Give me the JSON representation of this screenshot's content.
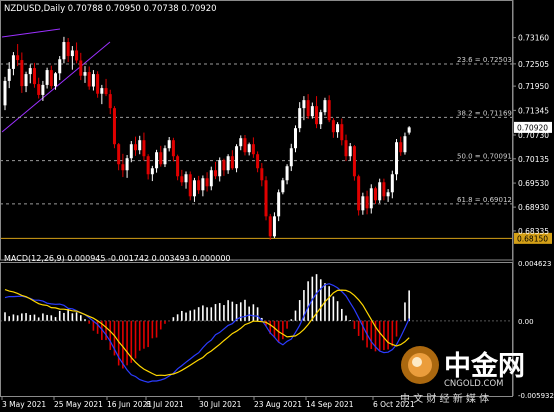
{
  "header": {
    "symbol_line": "NZDUSD,Daily  0.70788 0.70950 0.70738 0.70920"
  },
  "macd_header": "MACD(12,26,9) 0.000945 -0.001742 0.003493 0.000000",
  "fib_levels": [
    {
      "label": "23.6 = 0.72503",
      "value": 0.72503
    },
    {
      "label": "38.2 = 0.71169",
      "value": 0.71169
    },
    {
      "label": "50.0 = 0.70091",
      "value": 0.70091
    },
    {
      "label": "61.8 = 0.69012",
      "value": 0.69012
    }
  ],
  "support_line": {
    "value": 0.6815,
    "label": "0.68150",
    "color": "#d4a017"
  },
  "current_price": {
    "value": 0.7092,
    "label": "0.70920"
  },
  "watermark": {
    "brand": "中金网",
    "url": "CNGOLD.COM",
    "slogan": "中 文 财 经 新 媒 体"
  },
  "colors": {
    "bull": "#ffffff",
    "bear": "#e00000",
    "macd_line": "#2b3cff",
    "signal_line": "#ffd700",
    "trend": "#9b30ff"
  },
  "chart_data": {
    "type": "candlestick",
    "title": "NZDUSD,Daily",
    "price_axis": {
      "min": 0.6761,
      "max": 0.7365,
      "ticks": [
        "0.73160",
        "0.72505",
        "0.71950",
        "0.71345",
        "0.70730",
        "0.70135",
        "0.69530",
        "0.68930",
        "0.68335"
      ]
    },
    "time_axis": [
      "3 May 2021",
      "25 May 2021",
      "16 Jun 2021",
      "8 Jul 2021",
      "30 Jul 2021",
      "23 Aug 2021",
      "14 Sep 2021",
      "6 Oct 2021"
    ],
    "candles": [
      [
        0.7147,
        0.7218,
        0.7135,
        0.7208
      ],
      [
        0.7208,
        0.7255,
        0.719,
        0.7238
      ],
      [
        0.7238,
        0.728,
        0.7222,
        0.7272
      ],
      [
        0.7272,
        0.73,
        0.7245,
        0.726
      ],
      [
        0.726,
        0.7279,
        0.7178,
        0.7195
      ],
      [
        0.7195,
        0.7231,
        0.718,
        0.7225
      ],
      [
        0.7225,
        0.7249,
        0.7202,
        0.724
      ],
      [
        0.724,
        0.7253,
        0.7191,
        0.72
      ],
      [
        0.72,
        0.7216,
        0.7164,
        0.7173
      ],
      [
        0.7173,
        0.7208,
        0.7158,
        0.7198
      ],
      [
        0.7198,
        0.7241,
        0.7189,
        0.7235
      ],
      [
        0.7235,
        0.7246,
        0.7188,
        0.7195
      ],
      [
        0.7195,
        0.723,
        0.7186,
        0.7227
      ],
      [
        0.7227,
        0.727,
        0.721,
        0.7262
      ],
      [
        0.7262,
        0.7318,
        0.7252,
        0.7305
      ],
      [
        0.7305,
        0.7315,
        0.7255,
        0.727
      ],
      [
        0.727,
        0.7295,
        0.7236,
        0.7284
      ],
      [
        0.7284,
        0.7304,
        0.7252,
        0.7259
      ],
      [
        0.7259,
        0.7278,
        0.721,
        0.7221
      ],
      [
        0.7221,
        0.7245,
        0.7203,
        0.723
      ],
      [
        0.723,
        0.7244,
        0.7186,
        0.7194
      ],
      [
        0.7194,
        0.7235,
        0.7184,
        0.7225
      ],
      [
        0.7225,
        0.7232,
        0.7166,
        0.7176
      ],
      [
        0.7176,
        0.7198,
        0.715,
        0.719
      ],
      [
        0.719,
        0.7213,
        0.717,
        0.7175
      ],
      [
        0.7175,
        0.7186,
        0.7125,
        0.714
      ],
      [
        0.714,
        0.7145,
        0.704,
        0.705
      ],
      [
        0.705,
        0.7053,
        0.6985,
        0.7
      ],
      [
        0.7,
        0.7026,
        0.6968,
        0.6985
      ],
      [
        0.6985,
        0.7023,
        0.6966,
        0.7015
      ],
      [
        0.7015,
        0.7058,
        0.7005,
        0.705
      ],
      [
        0.705,
        0.7069,
        0.7021,
        0.7035
      ],
      [
        0.7035,
        0.7071,
        0.7025,
        0.706
      ],
      [
        0.706,
        0.7079,
        0.7009,
        0.702
      ],
      [
        0.702,
        0.7025,
        0.6962,
        0.6975
      ],
      [
        0.6975,
        0.6996,
        0.6958,
        0.699
      ],
      [
        0.699,
        0.7036,
        0.6979,
        0.703
      ],
      [
        0.703,
        0.7046,
        0.6994,
        0.7
      ],
      [
        0.7,
        0.7047,
        0.6993,
        0.704
      ],
      [
        0.704,
        0.7068,
        0.7032,
        0.706
      ],
      [
        0.706,
        0.7066,
        0.7007,
        0.702
      ],
      [
        0.702,
        0.7024,
        0.696,
        0.697
      ],
      [
        0.697,
        0.6986,
        0.6946,
        0.6955
      ],
      [
        0.6955,
        0.6982,
        0.6939,
        0.6975
      ],
      [
        0.6975,
        0.6982,
        0.691,
        0.692
      ],
      [
        0.692,
        0.6966,
        0.6906,
        0.696
      ],
      [
        0.696,
        0.6971,
        0.6926,
        0.6935
      ],
      [
        0.6935,
        0.6972,
        0.692,
        0.6965
      ],
      [
        0.6965,
        0.698,
        0.6932,
        0.6945
      ],
      [
        0.6945,
        0.6994,
        0.6935,
        0.6985
      ],
      [
        0.6985,
        0.7006,
        0.6963,
        0.697
      ],
      [
        0.697,
        0.7017,
        0.6957,
        0.701
      ],
      [
        0.701,
        0.7014,
        0.6971,
        0.6985
      ],
      [
        0.6985,
        0.7025,
        0.6976,
        0.702
      ],
      [
        0.702,
        0.7035,
        0.6986,
        0.699
      ],
      [
        0.699,
        0.705,
        0.698,
        0.7045
      ],
      [
        0.7045,
        0.7072,
        0.7035,
        0.7065
      ],
      [
        0.7065,
        0.7073,
        0.7022,
        0.703
      ],
      [
        0.703,
        0.7054,
        0.7022,
        0.705
      ],
      [
        0.705,
        0.7067,
        0.7016,
        0.7025
      ],
      [
        0.7025,
        0.7032,
        0.698,
        0.699
      ],
      [
        0.699,
        0.7003,
        0.6945,
        0.696
      ],
      [
        0.696,
        0.697,
        0.686,
        0.687
      ],
      [
        0.687,
        0.6876,
        0.6811,
        0.682
      ],
      [
        0.682,
        0.688,
        0.6816,
        0.687
      ],
      [
        0.687,
        0.6937,
        0.6858,
        0.693
      ],
      [
        0.693,
        0.6966,
        0.6925,
        0.696
      ],
      [
        0.696,
        0.7,
        0.695,
        0.6995
      ],
      [
        0.6995,
        0.7051,
        0.6983,
        0.704
      ],
      [
        0.704,
        0.7097,
        0.703,
        0.709
      ],
      [
        0.709,
        0.7155,
        0.708,
        0.714
      ],
      [
        0.714,
        0.717,
        0.711,
        0.716
      ],
      [
        0.716,
        0.7175,
        0.7113,
        0.712
      ],
      [
        0.712,
        0.7154,
        0.7114,
        0.7145
      ],
      [
        0.7145,
        0.717,
        0.709,
        0.71
      ],
      [
        0.71,
        0.7136,
        0.7088,
        0.713
      ],
      [
        0.713,
        0.7166,
        0.7122,
        0.716
      ],
      [
        0.716,
        0.7172,
        0.7105,
        0.711
      ],
      [
        0.711,
        0.7115,
        0.7066,
        0.708
      ],
      [
        0.708,
        0.7105,
        0.7066,
        0.71
      ],
      [
        0.71,
        0.7114,
        0.7047,
        0.706
      ],
      [
        0.706,
        0.7074,
        0.7008,
        0.702
      ],
      [
        0.702,
        0.7053,
        0.7009,
        0.7045
      ],
      [
        0.7045,
        0.7048,
        0.6959,
        0.697
      ],
      [
        0.697,
        0.6974,
        0.6872,
        0.6885
      ],
      [
        0.6885,
        0.6929,
        0.6874,
        0.692
      ],
      [
        0.692,
        0.6934,
        0.6875,
        0.689
      ],
      [
        0.689,
        0.695,
        0.6877,
        0.694
      ],
      [
        0.694,
        0.6944,
        0.6901,
        0.691
      ],
      [
        0.691,
        0.6964,
        0.6903,
        0.6955
      ],
      [
        0.6955,
        0.6964,
        0.691,
        0.692
      ],
      [
        0.692,
        0.6938,
        0.6906,
        0.693
      ],
      [
        0.693,
        0.6984,
        0.6915,
        0.6975
      ],
      [
        0.6975,
        0.7063,
        0.696,
        0.7055
      ],
      [
        0.7055,
        0.7069,
        0.7021,
        0.703
      ],
      [
        0.703,
        0.7079,
        0.7024,
        0.707
      ],
      [
        0.7079,
        0.7095,
        0.7074,
        0.7092
      ]
    ],
    "macd": {
      "label": "MACD(12,26,9)",
      "ticks": [
        "0.004623",
        "0.00",
        "-0.005932"
      ],
      "range": [
        -0.005932,
        0.004623
      ],
      "histogram": [
        0.00068,
        0.00037,
        0.00051,
        0.00044,
        0.00059,
        0.00062,
        0.00047,
        0.0005,
        0.00027,
        0.00059,
        0.00047,
        0.00044,
        0.0003,
        0.00079,
        0.00063,
        0.00093,
        0.0006,
        0.00068,
        0.00045,
        0.00013,
        -0.00023,
        -0.00079,
        -0.00104,
        -0.00153,
        -0.00154,
        -0.00233,
        -0.00277,
        -0.00357,
        -0.00381,
        -0.00356,
        -0.00336,
        -0.00301,
        -0.00239,
        -0.00223,
        -0.0021,
        -0.0014,
        -0.00134,
        -0.00069,
        -0.00024,
        -4e-05,
        0.00029,
        0.00052,
        0.00079,
        0.00066,
        0.00082,
        0.0009,
        0.00109,
        0.00123,
        0.00108,
        0.00108,
        0.00134,
        0.00142,
        0.00126,
        0.00165,
        0.00153,
        0.00134,
        0.00148,
        0.00168,
        0.00114,
        0.00132,
        0.00108,
        0.00023,
        -0.00039,
        -0.00106,
        -0.00135,
        -0.00174,
        -0.00147,
        -0.00063,
        0.00012,
        0.00082,
        0.00166,
        0.00246,
        0.00316,
        0.00353,
        0.00373,
        0.00332,
        0.00301,
        0.00277,
        0.00195,
        0.00157,
        0.00095,
        0.00042,
        6e-05,
        -0.00065,
        -0.00121,
        -0.00156,
        -0.00213,
        -0.00225,
        -0.00244,
        -0.00239,
        -0.00234,
        -0.00229,
        -0.00203,
        -0.00126,
        -2e-05,
        0.00147,
        0.00243
      ],
      "macd_line": [
        0.00186,
        0.00194,
        0.00194,
        0.00195,
        0.00197,
        0.00189,
        0.00179,
        0.00165,
        0.00165,
        0.00158,
        0.00141,
        0.00135,
        0.00132,
        0.00134,
        0.00124,
        0.00099,
        0.00096,
        0.00081,
        0.00065,
        0.0005,
        0.00024,
        -2e-05,
        -0.0003,
        -0.00069,
        -0.00112,
        -0.00164,
        -0.00228,
        -0.00292,
        -0.00343,
        -0.00393,
        -0.00432,
        -0.00445,
        -0.0047,
        -0.00482,
        -0.00491,
        -0.00481,
        -0.00481,
        -0.00473,
        -0.00462,
        -0.00441,
        -0.00419,
        -0.00384,
        -0.00358,
        -0.00331,
        -0.00305,
        -0.00278,
        -0.00255,
        -0.00214,
        -0.00179,
        -0.00154,
        -0.00111,
        -0.00093,
        -0.00065,
        -0.00037,
        -0.00023,
        0.00012,
        0.00029,
        0.00034,
        0.00047,
        0.00039,
        0.00038,
        4e-05,
        -0.00043,
        -0.00097,
        -0.0013,
        -0.00171,
        -0.00192,
        -0.00164,
        -0.00146,
        -0.00093,
        -0.00036,
        0.00038,
        0.00108,
        0.0017,
        0.00219,
        0.00257,
        0.00288,
        0.00297,
        0.00283,
        0.00263,
        0.00234,
        0.00199,
        0.00144,
        0.0009,
        0.00025,
        -0.00045,
        -0.00109,
        -0.00167,
        -0.00208,
        -0.00242,
        -0.00254,
        -0.00251,
        -0.00231,
        -0.00191,
        -0.00129,
        -0.00058,
        0.00018
      ],
      "signal_line": [
        0.0025,
        0.00238,
        0.00231,
        0.00219,
        0.00203,
        0.00193,
        0.00175,
        0.00155,
        0.00137,
        0.00127,
        0.00123,
        0.00106,
        0.00103,
        0.00094,
        0.00093,
        0.00087,
        0.0008,
        0.00078,
        0.00064,
        0.0005,
        0.00035,
        0.00021,
        0.0,
        -0.00024,
        -0.00052,
        -0.00084,
        -0.00119,
        -0.00168,
        -0.00208,
        -0.0025,
        -0.00293,
        -0.00331,
        -0.00361,
        -0.00386,
        -0.00404,
        -0.00421,
        -0.00437,
        -0.00435,
        -0.00437,
        -0.0043,
        -0.00425,
        -0.00413,
        -0.00396,
        -0.00376,
        -0.00356,
        -0.00333,
        -0.00312,
        -0.00293,
        -0.00262,
        -0.00241,
        -0.00214,
        -0.00188,
        -0.00158,
        -0.00131,
        -0.00102,
        -0.00083,
        -0.0006,
        -0.0003,
        -0.00018,
        -2e-05,
        -4e-05,
        -7e-05,
        -0.00012,
        -0.00032,
        -0.00057,
        -0.00087,
        -0.00107,
        -0.00129,
        -0.00125,
        -0.00121,
        -0.00099,
        -0.00069,
        -0.0003,
        0.00015,
        0.00059,
        0.00106,
        0.00153,
        0.00187,
        0.00223,
        0.00243,
        0.00246,
        0.00243,
        0.0023,
        0.00203,
        0.00168,
        0.00125,
        0.00067,
        0.0001,
        -0.00049,
        -0.00095,
        -0.00134,
        -0.00173,
        -0.00189,
        -0.00201,
        -0.0019,
        -0.00168,
        -0.00135
      ]
    }
  }
}
